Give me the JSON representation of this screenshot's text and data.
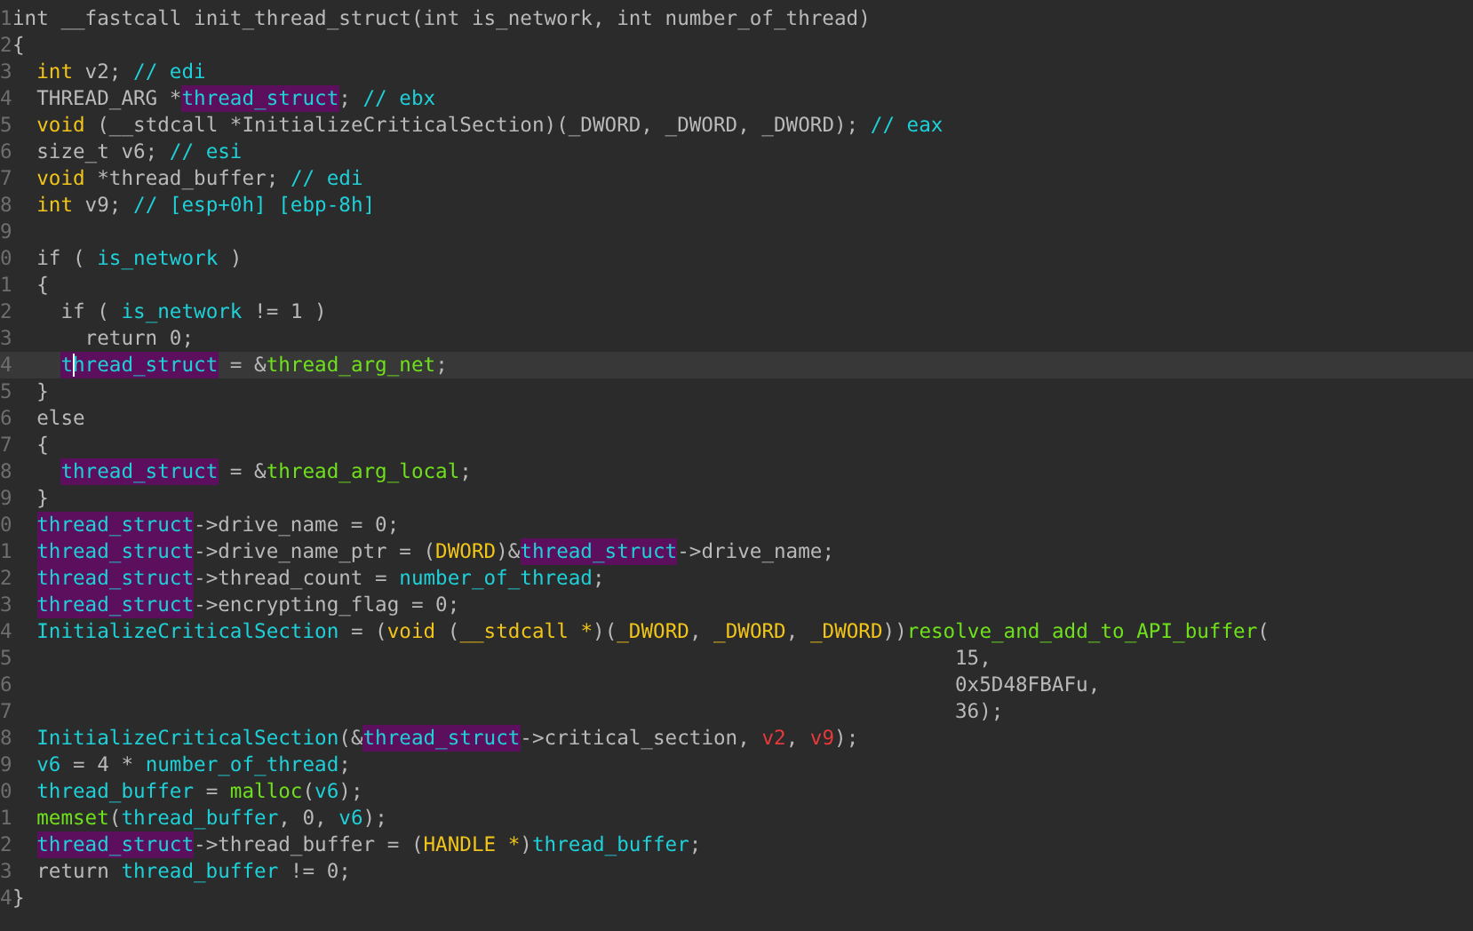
{
  "code_lines": [
    {
      "number": "1",
      "current": false,
      "kind": "top",
      "tokens": [
        {
          "kind": "plain",
          "text": "int __fastcall init_thread_struct(int is_network, int number_of_thread)"
        }
      ]
    },
    {
      "number": "2",
      "current": false,
      "kind": "top",
      "tokens": [
        {
          "kind": "plain",
          "text": "{"
        }
      ]
    },
    {
      "number": "3",
      "current": false,
      "kind": "body",
      "tokens": [
        {
          "kind": "keyword",
          "text": "int"
        },
        {
          "kind": "plain",
          "text": " v2; "
        },
        {
          "kind": "comment",
          "text": "// edi"
        }
      ]
    },
    {
      "number": "4",
      "current": false,
      "kind": "body",
      "tokens": [
        {
          "kind": "plain",
          "text": "THREAD_ARG *"
        },
        {
          "kind": "highlight",
          "text": "thread_struct"
        },
        {
          "kind": "plain",
          "text": "; "
        },
        {
          "kind": "comment",
          "text": "// ebx"
        }
      ]
    },
    {
      "number": "5",
      "current": false,
      "kind": "body",
      "tokens": [
        {
          "kind": "keyword",
          "text": "void"
        },
        {
          "kind": "plain",
          "text": " (__stdcall *InitializeCriticalSection)(_DWORD, _DWORD, _DWORD); "
        },
        {
          "kind": "comment",
          "text": "// eax"
        }
      ]
    },
    {
      "number": "6",
      "current": false,
      "kind": "body",
      "tokens": [
        {
          "kind": "plain",
          "text": "size_t v6; "
        },
        {
          "kind": "comment",
          "text": "// esi"
        }
      ]
    },
    {
      "number": "7",
      "current": false,
      "kind": "body",
      "tokens": [
        {
          "kind": "keyword",
          "text": "void"
        },
        {
          "kind": "plain",
          "text": " *thread_buffer; "
        },
        {
          "kind": "comment",
          "text": "// edi"
        }
      ]
    },
    {
      "number": "8",
      "current": false,
      "kind": "body",
      "tokens": [
        {
          "kind": "keyword",
          "text": "int"
        },
        {
          "kind": "plain",
          "text": " v9; "
        },
        {
          "kind": "comment",
          "text": "// [esp+0h] [ebp-8h]"
        }
      ]
    },
    {
      "number": "9",
      "current": false,
      "kind": "top"
    },
    {
      "number": "0",
      "current": false,
      "kind": "body",
      "tokens": [
        {
          "kind": "plain",
          "text": "if ( "
        },
        {
          "kind": "ident",
          "text": "is_network"
        },
        {
          "kind": "plain",
          "text": " )"
        }
      ]
    },
    {
      "number": "1",
      "current": false,
      "kind": "body",
      "tokens": [
        {
          "kind": "plain",
          "text": "{"
        }
      ]
    },
    {
      "number": "2",
      "current": false,
      "kind": "nested",
      "tokens": [
        {
          "kind": "plain",
          "text": "if ( "
        },
        {
          "kind": "ident",
          "text": "is_network"
        },
        {
          "kind": "plain",
          "text": " != 1 )"
        }
      ]
    },
    {
      "number": "3",
      "current": false,
      "kind": "deep",
      "tokens": [
        {
          "kind": "plain",
          "text": "return 0;"
        }
      ]
    },
    {
      "number": "4",
      "current": true,
      "kind": "nested",
      "tokens": [
        {
          "kind": "highlight",
          "text": "thread_struct"
        },
        {
          "kind": "plain",
          "text": " = &"
        },
        {
          "kind": "func",
          "text": "thread_arg_net"
        },
        {
          "kind": "plain",
          "text": ";"
        }
      ]
    },
    {
      "number": "5",
      "current": false,
      "kind": "body",
      "tokens": [
        {
          "kind": "plain",
          "text": "}"
        }
      ]
    },
    {
      "number": "6",
      "current": false,
      "kind": "body",
      "tokens": [
        {
          "kind": "plain",
          "text": "else"
        }
      ]
    },
    {
      "number": "7",
      "current": false,
      "kind": "body",
      "tokens": [
        {
          "kind": "plain",
          "text": "{"
        }
      ]
    },
    {
      "number": "8",
      "current": false,
      "kind": "nested",
      "tokens": [
        {
          "kind": "highlight",
          "text": "thread_struct"
        },
        {
          "kind": "plain",
          "text": " = &"
        },
        {
          "kind": "func",
          "text": "thread_arg_local"
        },
        {
          "kind": "plain",
          "text": ";"
        }
      ]
    },
    {
      "number": "9",
      "current": false,
      "kind": "body",
      "tokens": [
        {
          "kind": "plain",
          "text": "}"
        }
      ]
    },
    {
      "number": "0",
      "current": false,
      "kind": "body",
      "tokens": [
        {
          "kind": "highlight",
          "text": "thread_struct"
        },
        {
          "kind": "plain",
          "text": "->drive_name = 0;"
        }
      ]
    },
    {
      "number": "1",
      "current": false,
      "kind": "body",
      "tokens": [
        {
          "kind": "highlight",
          "text": "thread_struct"
        },
        {
          "kind": "plain",
          "text": "->drive_name_ptr = ("
        },
        {
          "kind": "keyword",
          "text": "DWORD"
        },
        {
          "kind": "plain",
          "text": ")&"
        },
        {
          "kind": "highlight",
          "text": "thread_struct"
        },
        {
          "kind": "plain",
          "text": "->drive_name;"
        }
      ]
    },
    {
      "number": "2",
      "current": false,
      "kind": "body",
      "tokens": [
        {
          "kind": "highlight",
          "text": "thread_struct"
        },
        {
          "kind": "plain",
          "text": "->thread_count = "
        },
        {
          "kind": "ident",
          "text": "number_of_thread"
        },
        {
          "kind": "plain",
          "text": ";"
        }
      ]
    },
    {
      "number": "3",
      "current": false,
      "kind": "body",
      "tokens": [
        {
          "kind": "highlight",
          "text": "thread_struct"
        },
        {
          "kind": "plain",
          "text": "->encrypting_flag = 0;"
        }
      ]
    },
    {
      "number": "4",
      "current": false,
      "kind": "body",
      "tokens": [
        {
          "kind": "ident",
          "text": "InitializeCriticalSection"
        },
        {
          "kind": "plain",
          "text": " = ("
        },
        {
          "kind": "keyword",
          "text": "void"
        },
        {
          "kind": "plain",
          "text": " ("
        },
        {
          "kind": "keyword",
          "text": "__stdcall *"
        },
        {
          "kind": "plain",
          "text": ")("
        },
        {
          "kind": "keyword",
          "text": "_DWORD"
        },
        {
          "kind": "plain",
          "text": ", "
        },
        {
          "kind": "keyword",
          "text": "_DWORD"
        },
        {
          "kind": "plain",
          "text": ", "
        },
        {
          "kind": "keyword",
          "text": "_DWORD"
        },
        {
          "kind": "plain",
          "text": "))"
        },
        {
          "kind": "func",
          "text": "resolve_and_add_to_API_buffer"
        },
        {
          "kind": "plain",
          "text": "("
        }
      ]
    },
    {
      "number": "5",
      "current": false,
      "kind": "argument",
      "tokens": [
        {
          "kind": "plain",
          "text": "15,"
        }
      ]
    },
    {
      "number": "6",
      "current": false,
      "kind": "argument",
      "tokens": [
        {
          "kind": "plain",
          "text": "0x5D48FBAFu,"
        }
      ]
    },
    {
      "number": "7",
      "current": false,
      "kind": "argument",
      "tokens": [
        {
          "kind": "plain",
          "text": "36);"
        }
      ]
    },
    {
      "number": "8",
      "current": false,
      "kind": "body",
      "tokens": [
        {
          "kind": "ident",
          "text": "InitializeCriticalSection"
        },
        {
          "kind": "plain",
          "text": "(&"
        },
        {
          "kind": "highlight",
          "text": "thread_struct"
        },
        {
          "kind": "plain",
          "text": "->critical_section, "
        },
        {
          "kind": "var",
          "text": "v2"
        },
        {
          "kind": "plain",
          "text": ", "
        },
        {
          "kind": "var",
          "text": "v9"
        },
        {
          "kind": "plain",
          "text": ");"
        }
      ]
    },
    {
      "number": "9",
      "current": false,
      "kind": "body",
      "tokens": [
        {
          "kind": "ident",
          "text": "v6"
        },
        {
          "kind": "plain",
          "text": " = 4 * "
        },
        {
          "kind": "ident",
          "text": "number_of_thread"
        },
        {
          "kind": "plain",
          "text": ";"
        }
      ]
    },
    {
      "number": "0",
      "current": false,
      "kind": "body",
      "tokens": [
        {
          "kind": "ident",
          "text": "thread_buffer"
        },
        {
          "kind": "plain",
          "text": " = "
        },
        {
          "kind": "func",
          "text": "malloc"
        },
        {
          "kind": "plain",
          "text": "("
        },
        {
          "kind": "ident",
          "text": "v6"
        },
        {
          "kind": "plain",
          "text": ");"
        }
      ]
    },
    {
      "number": "1",
      "current": false,
      "kind": "body",
      "tokens": [
        {
          "kind": "func",
          "text": "memset"
        },
        {
          "kind": "plain",
          "text": "("
        },
        {
          "kind": "ident",
          "text": "thread_buffer"
        },
        {
          "kind": "plain",
          "text": ", 0, "
        },
        {
          "kind": "ident",
          "text": "v6"
        },
        {
          "kind": "plain",
          "text": ");"
        }
      ]
    },
    {
      "number": "2",
      "current": false,
      "kind": "body",
      "tokens": [
        {
          "kind": "highlight",
          "text": "thread_struct"
        },
        {
          "kind": "plain",
          "text": "->thread_buffer = ("
        },
        {
          "kind": "keyword",
          "text": "HANDLE *"
        },
        {
          "kind": "plain",
          "text": ")"
        },
        {
          "kind": "ident",
          "text": "thread_buffer"
        },
        {
          "kind": "plain",
          "text": ";"
        }
      ]
    },
    {
      "number": "3",
      "current": false,
      "kind": "body",
      "tokens": [
        {
          "kind": "plain",
          "text": "return "
        },
        {
          "kind": "ident",
          "text": "thread_buffer"
        },
        {
          "kind": "plain",
          "text": " != 0;"
        }
      ]
    },
    {
      "number": "4",
      "current": false,
      "kind": "top",
      "tokens": [
        {
          "kind": "plain",
          "text": "}"
        }
      ]
    }
  ]
}
